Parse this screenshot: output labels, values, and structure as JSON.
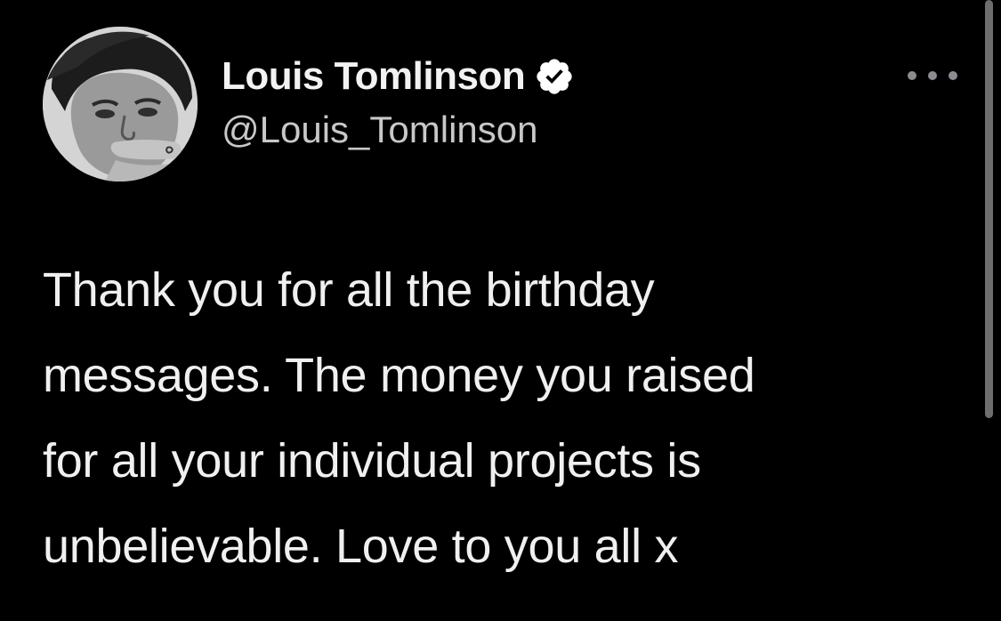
{
  "author": {
    "display_name": "Louis Tomlinson",
    "handle": "@Louis_Tomlinson",
    "verified": true
  },
  "icons": {
    "avatar": "profile-photo",
    "verified": "verified-badge-icon",
    "more": "more-horizontal-icon"
  },
  "tweet": {
    "lines": [
      "Thank you for all the birthday",
      "messages. The money you raised",
      "for all your individual projects is",
      "unbelievable. Love to you all x"
    ]
  },
  "colors": {
    "background": "#000000",
    "text": "#f0f0f0",
    "secondary_text": "#c8c8c8",
    "more_dots": "#8a8d91",
    "scrollbar": "#6e6e6e"
  }
}
